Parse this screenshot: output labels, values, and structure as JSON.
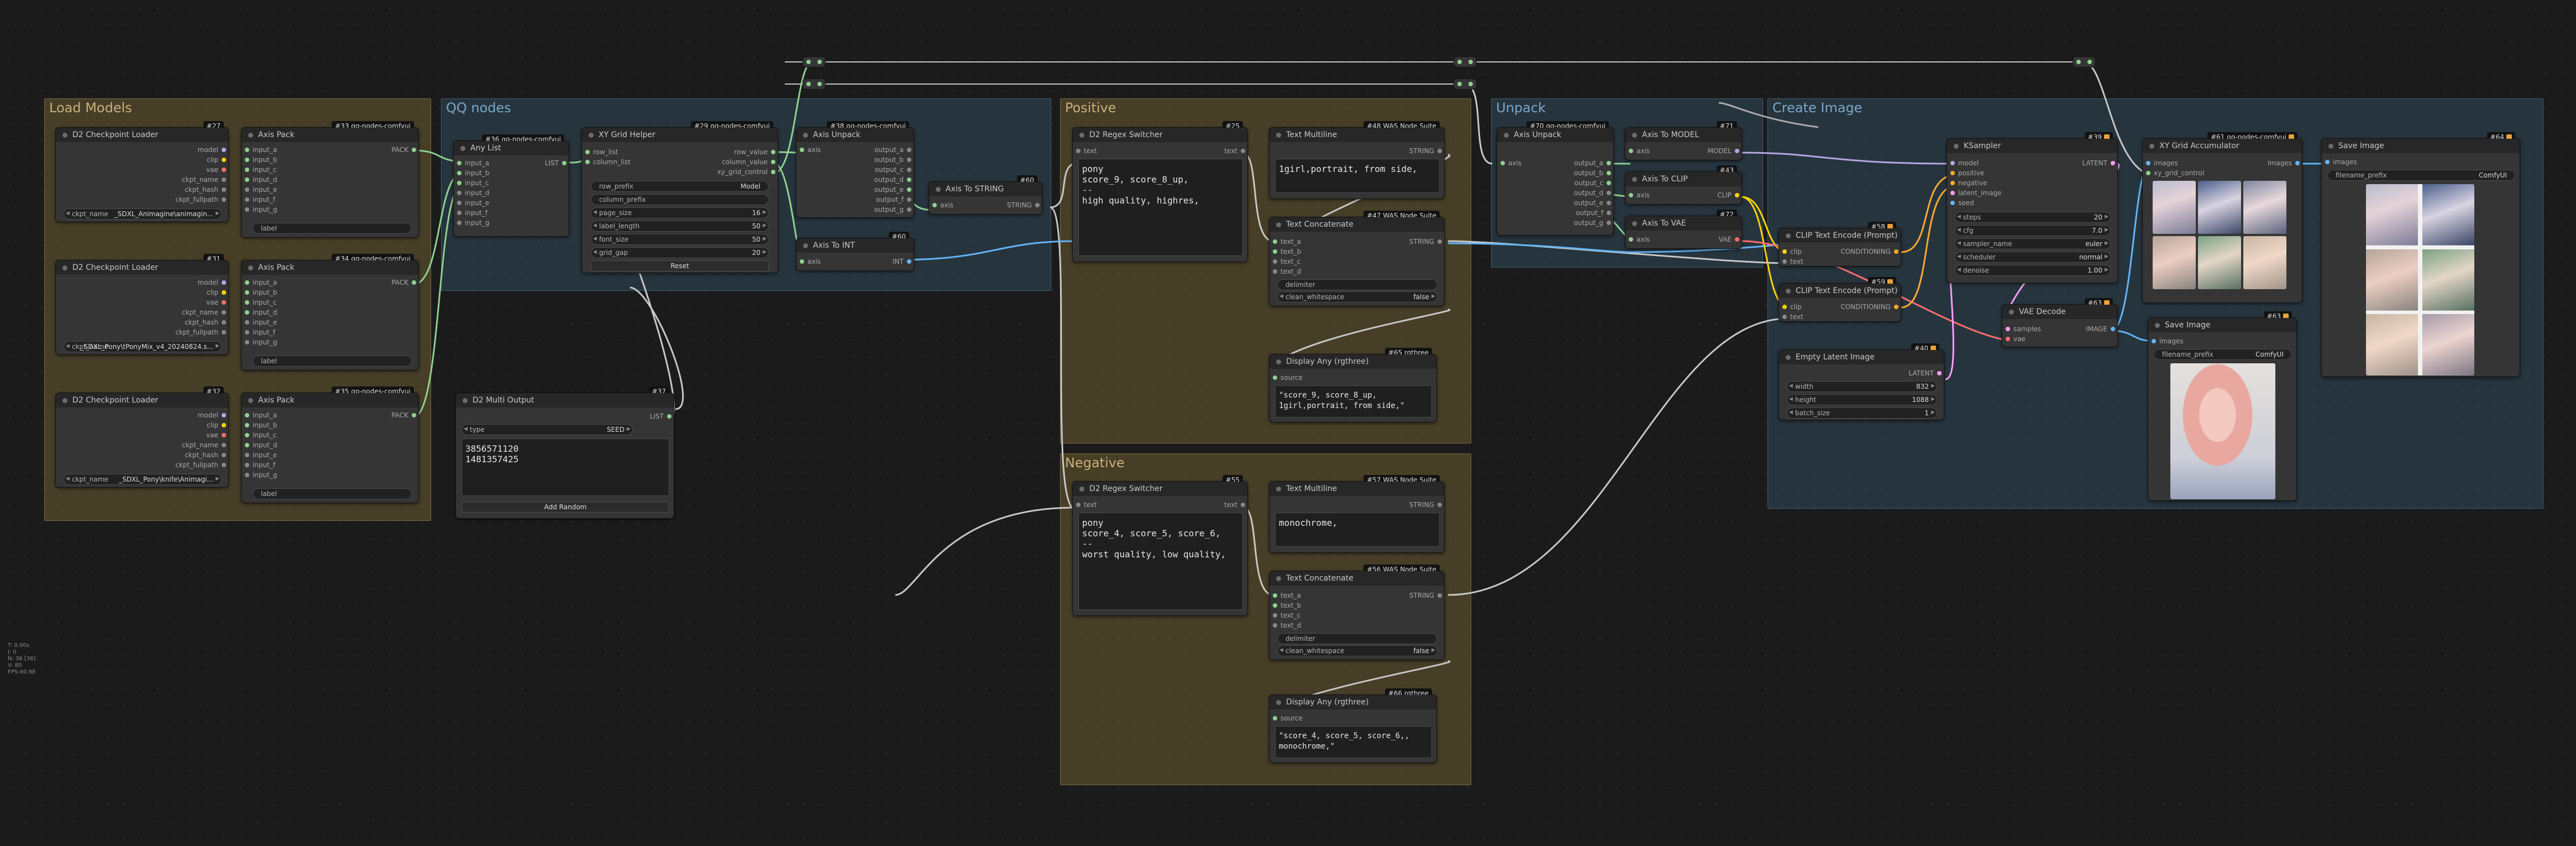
{
  "groups": {
    "load": "Load Models",
    "qq": "QQ nodes",
    "positive": "Positive",
    "negative": "Negative",
    "unpack": "Unpack",
    "create": "Create Image"
  },
  "ckpt": {
    "title": "D2 Checkpoint Loader",
    "outs": [
      "model",
      "clip",
      "vae",
      "ckpt_name",
      "ckpt_hash",
      "ckpt_fullpath"
    ],
    "name_label": "ckpt_name",
    "n27": "#27",
    "n31": "#31",
    "n32": "#32",
    "v27": "_SDXL_Animagine\\animagin...",
    "v31": "_SDXL_Pony\\tPonyMix_v4_20240824.s...",
    "v32": "_SDXL_Pony\\knife\\Animagi..."
  },
  "pack": {
    "title": "Axis Pack",
    "badge33": "#33 qq-nodes-comfyui",
    "badge34": "#34 qq-nodes-comfyui",
    "badge35": "#35 qq-nodes-comfyui",
    "ins": [
      "input_a",
      "input_b",
      "input_c",
      "input_d",
      "input_e",
      "input_f",
      "input_g"
    ],
    "out": "PACK",
    "label_w": "label"
  },
  "anylist": {
    "title": "Any List",
    "badge": "#36 qq-nodes-comfyui",
    "ins": [
      "input_a",
      "input_b",
      "input_c",
      "input_d",
      "input_e",
      "input_f",
      "input_g"
    ],
    "out": "LIST"
  },
  "xy": {
    "title": "XY Grid Helper",
    "badge": "#29 qq-nodes-comfyui",
    "ins": [
      "row_list",
      "column_list"
    ],
    "outs": [
      "row_value",
      "column_value",
      "xy_grid_control"
    ],
    "w_row_prefix": "row_prefix",
    "w_row_prefix_v": "Model",
    "w_col_prefix": "column_prefix",
    "w_page": "page_size",
    "w_page_v": "16",
    "w_label": "label_length",
    "w_label_v": "50",
    "w_font": "font_size",
    "w_font_v": "50",
    "w_grid": "grid_gap",
    "w_grid_v": "20",
    "reset": "Reset"
  },
  "unpack38": {
    "title": "Axis Unpack",
    "badge": "#38 qq-nodes-comfyui",
    "in": "axis",
    "outs": [
      "output_a",
      "output_b",
      "output_c",
      "output_d",
      "output_e",
      "output_f",
      "output_g"
    ]
  },
  "tostr": {
    "title": "Axis To STRING",
    "badge": "#60",
    "in": "axis",
    "out": "STRING"
  },
  "toint": {
    "title": "Axis To INT",
    "badge": "#60",
    "in": "axis",
    "out": "INT"
  },
  "multi": {
    "title": "D2 Multi Output",
    "badge": "#37",
    "w_type": "type",
    "w_type_v": "SEED",
    "out": "LIST",
    "text": "3856571120\n1481357425",
    "add": "Add Random"
  },
  "regexP": {
    "title": "D2 Regex Switcher",
    "badge": "#25",
    "in": "text",
    "out": "text",
    "text": "pony\nscore_9, score_8_up,\n--\nhigh quality, highres,"
  },
  "regexN": {
    "title": "D2 Regex Switcher",
    "badge": "#55",
    "in": "text",
    "out": "text",
    "text": "pony\nscore_4, score_5, score_6,\n--\nworst quality, low quality,"
  },
  "mlP": {
    "title": "Text Multiline",
    "badge": "#48 WAS Node Suite",
    "out": "STRING",
    "text": "1girl,portrait, from side,"
  },
  "mlN": {
    "title": "Text Multiline",
    "badge": "#57 WAS Node Suite",
    "out": "STRING",
    "text": "monochrome,"
  },
  "concatP": {
    "title": "Text Concatenate",
    "badge": "#47 WAS Node Suite",
    "ins": [
      "text_a",
      "text_b",
      "text_c",
      "text_d"
    ],
    "out": "STRING",
    "w_delim": "delimiter",
    "w_clean": "clean_whitespace",
    "w_clean_v": "false"
  },
  "concatN": {
    "title": "Text Concatenate",
    "badge": "#56 WAS Node Suite",
    "ins": [
      "text_a",
      "text_b",
      "text_c",
      "text_d"
    ],
    "out": "STRING",
    "w_delim": "delimiter",
    "w_clean": "clean_whitespace",
    "w_clean_v": "false"
  },
  "dispP": {
    "title": "Display Any (rgthree)",
    "badge": "#65 rgthree",
    "in": "source",
    "text": "\"score_9, score_8_up,\n1girl,portrait, from side,\""
  },
  "dispN": {
    "title": "Display Any (rgthree)",
    "badge": "#66 rgthree",
    "in": "source",
    "text": "\"score_4, score_5, score_6,,\nmonochrome,\""
  },
  "unpack70": {
    "title": "Axis Unpack",
    "badge": "#70 qq-nodes-comfyui",
    "in": "axis",
    "outs": [
      "output_a",
      "output_b",
      "output_c",
      "output_d",
      "output_e",
      "output_f",
      "output_g"
    ]
  },
  "toModel": {
    "title": "Axis To MODEL",
    "badge": "#71",
    "in": "axis",
    "out": "MODEL"
  },
  "toClip": {
    "title": "Axis To CLIP",
    "badge": "#43",
    "in": "axis",
    "out": "CLIP"
  },
  "toVae": {
    "title": "Axis To VAE",
    "badge": "#72",
    "in": "axis",
    "out": "VAE"
  },
  "clipP": {
    "title": "CLIP Text Encode (Prompt)",
    "badge": "#58",
    "ins": [
      "clip",
      "text"
    ],
    "out": "CONDITIONING"
  },
  "clipN": {
    "title": "CLIP Text Encode (Prompt)",
    "badge": "#59",
    "ins": [
      "clip",
      "text"
    ],
    "out": "CONDITIONING"
  },
  "latent": {
    "title": "Empty Latent Image",
    "badge": "#40",
    "out": "LATENT",
    "w_width": "width",
    "w_width_v": "832",
    "w_height": "height",
    "w_height_v": "1088",
    "w_batch": "batch_size",
    "w_batch_v": "1"
  },
  "ksampler": {
    "title": "KSampler",
    "badge": "#39",
    "ins": [
      "model",
      "positive",
      "negative",
      "latent_image",
      "seed"
    ],
    "out": "LATENT",
    "w_steps": "steps",
    "w_steps_v": "20",
    "w_cfg": "cfg",
    "w_cfg_v": "7.0",
    "w_sampler": "sampler_name",
    "w_sampler_v": "euler",
    "w_sched": "scheduler",
    "w_sched_v": "normal",
    "w_denoise": "denoise",
    "w_denoise_v": "1.00"
  },
  "vaedec": {
    "title": "VAE Decode",
    "badge": "#63",
    "ins": [
      "samples",
      "vae"
    ],
    "out": "IMAGE"
  },
  "xyacc": {
    "title": "XY Grid Accumulator",
    "badge": "#61 qq-nodes-comfyui",
    "ins": [
      "images",
      "xy_grid_control"
    ],
    "out": "Images"
  },
  "save1": {
    "title": "Save Image",
    "badge": "#63",
    "in": "images",
    "w_prefix": "filename_prefix",
    "w_prefix_v": "ComfyUI"
  },
  "save2": {
    "title": "Save Image",
    "badge": "#64",
    "in": "images",
    "w_prefix": "filename_prefix",
    "w_prefix_v": "ComfyUI"
  },
  "stats": [
    "T: 0.00s",
    "I: 0",
    "N: 36 [36]",
    "V: 80",
    "FPS:40.98"
  ]
}
